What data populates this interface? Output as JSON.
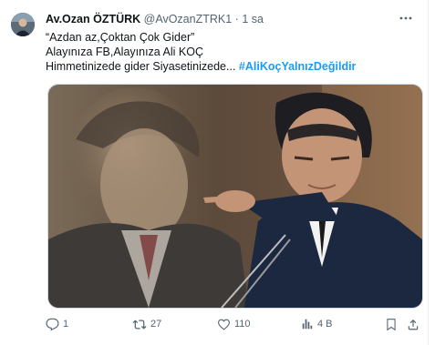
{
  "tweet": {
    "author_name": "Av.Ozan ÖZTÜRK",
    "handle": "@AvOzanZTRK1",
    "separator": "·",
    "time": "1 sa",
    "lines": [
      "“Azdan az,Çoktan Çok Gider”",
      "Alayınıza FB,Alayınıza Ali KOÇ",
      "Himmetinizede gider Siyasetinizede..."
    ],
    "hashtag": "#AliKoçYalnızDeğildir"
  },
  "actions": {
    "reply_count": "1",
    "retweet_count": "27",
    "like_count": "110",
    "views_count": "4 B"
  },
  "icons": {
    "more": "more-dots-icon",
    "reply": "reply-icon",
    "retweet": "retweet-icon",
    "like": "heart-icon",
    "views": "views-chart-icon",
    "bookmark": "bookmark-icon",
    "share": "share-icon"
  },
  "colors": {
    "accent": "#1d9bf0",
    "muted": "#536471",
    "text": "#0f1419"
  }
}
